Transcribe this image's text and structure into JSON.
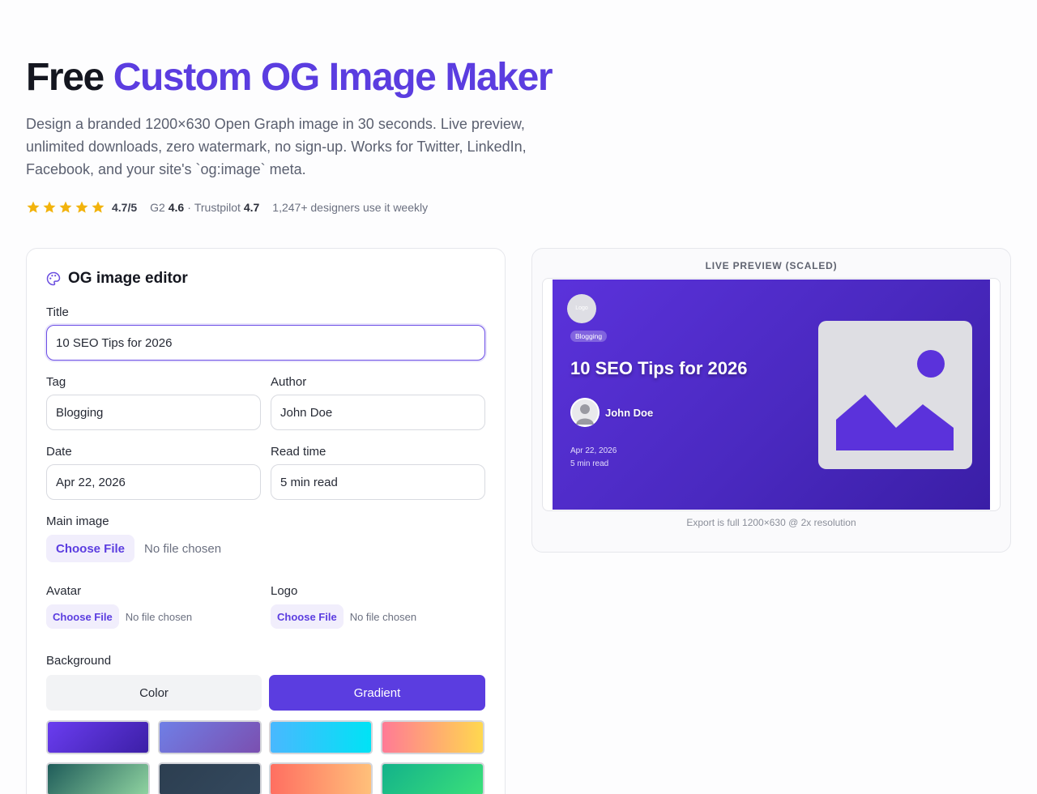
{
  "hero": {
    "title_lead": "Free",
    "title_accent": "Custom OG Image Maker",
    "subtitle": "Design a branded 1200×630 Open Graph image in 30 seconds. Live preview, unlimited downloads, zero watermark, no sign-up. Works for Twitter, LinkedIn, Facebook, and your site's `og:image` meta."
  },
  "rating": {
    "stars": 5,
    "star_color": "#f2b30c",
    "score": "4.7/5",
    "g2_label": "G2",
    "g2_score": "4.6",
    "separator": "·",
    "trustpilot_label": "Trustpilot",
    "trustpilot_score": "4.7",
    "users": "1,247+ designers use it weekly"
  },
  "editor": {
    "heading": "OG image editor",
    "heading_icon": "palette-icon",
    "title_label": "Title",
    "title_value": "10 SEO Tips for 2026",
    "tag_label": "Tag",
    "tag_value": "Blogging",
    "author_label": "Author",
    "author_value": "John Doe",
    "date_label": "Date",
    "date_value": "Apr 22, 2026",
    "read_time_label": "Read time",
    "read_time_value": "5 min read",
    "main_image_label": "Main image",
    "avatar_label": "Avatar",
    "logo_label": "Logo",
    "choose_file": "Choose File",
    "no_file": "No file chosen",
    "background_label": "Background",
    "bg_color_option": "Color",
    "bg_gradient_option": "Gradient",
    "bg_selected": "Gradient",
    "accent_color": "#5b3de0",
    "gradient_swatches": [
      "linear-gradient(135deg, #6a3df0 0%, #3c1fa6 100%)",
      "linear-gradient(135deg, #6f7fe6 0%, #7b4fb0 100%)",
      "linear-gradient(90deg, #49b8ff 0%, #00e3f5 100%)",
      "linear-gradient(90deg, #ff7a95 0%, #ffd84f 100%)",
      "linear-gradient(135deg, #1f5c5a 0%, #8fd3a0 100%)",
      "linear-gradient(135deg, #2c3e50 0%, #34495e 100%)",
      "linear-gradient(90deg, #ff6f61 0%, #ffc07a 100%)",
      "linear-gradient(135deg, #13b28a 0%, #3be07a 100%)"
    ]
  },
  "preview": {
    "label": "LIVE PREVIEW (SCALED)",
    "logo_text": "Logo",
    "tag": "Blogging",
    "title": "10 SEO Tips for 2026",
    "author": "John Doe",
    "date": "Apr 22, 2026",
    "read_time": "5 min read",
    "note": "Export is full 1200×630 @ 2x resolution"
  }
}
